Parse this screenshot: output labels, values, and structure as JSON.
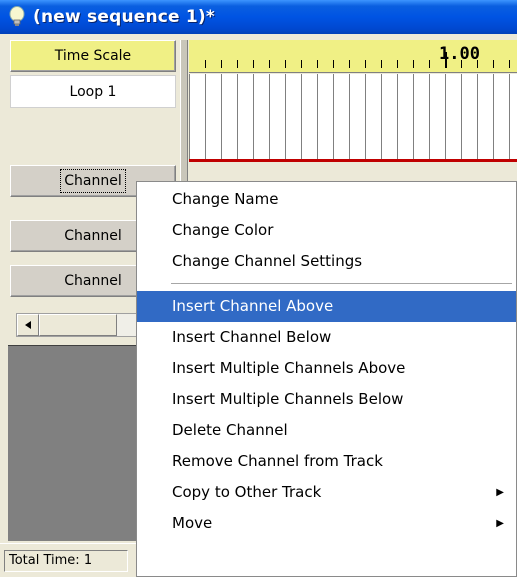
{
  "window": {
    "title": "(new sequence 1)*"
  },
  "rows": {
    "time_scale": "Time Scale",
    "loop": "Loop 1",
    "channels": [
      "Channel",
      "Channel",
      "Channel"
    ]
  },
  "ruler": {
    "time_label": "1.00"
  },
  "status": {
    "total_time": "Total Time: 1"
  },
  "context_menu": {
    "items": [
      "Change Name",
      "Change Color",
      "Change Channel Settings",
      "Insert Channel Above",
      "Insert Channel Below",
      "Insert Multiple Channels Above",
      "Insert Multiple Channels Below",
      "Delete Channel",
      "Remove Channel from Track",
      "Copy to Other Track",
      "Move"
    ],
    "highlighted_index": 3,
    "submenu_indices": [
      9,
      10
    ]
  },
  "colors": {
    "title_bar": "#0054e3",
    "time_scale_bg": "#f0f085",
    "highlight": "#316ac5",
    "loop_line": "#c00000"
  }
}
